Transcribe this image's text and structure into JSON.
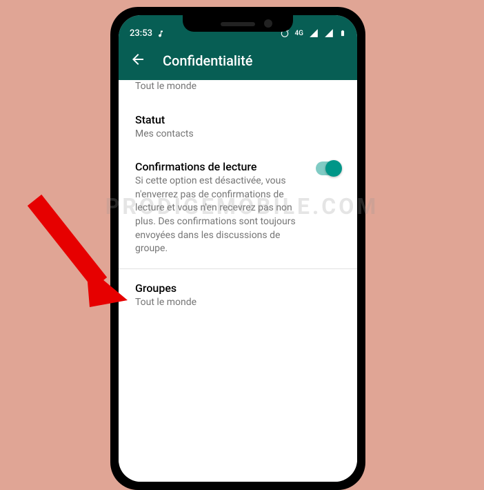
{
  "status_bar": {
    "time": "23:53",
    "network": "4G"
  },
  "header": {
    "title": "Confidentialité"
  },
  "settings": {
    "item0_subtitle": "Tout le monde",
    "statut": {
      "title": "Statut",
      "subtitle": "Mes contacts"
    },
    "read_receipts": {
      "title": "Confirmations de lecture",
      "description": "Si cette option est désactivée, vous n'enverrez pas de confirmations de lecture et vous n'en recevrez pas non plus. Des confirmations sont toujours envoyées dans les discussions de groupe."
    },
    "groupes": {
      "title": "Groupes",
      "subtitle": "Tout le monde"
    }
  },
  "watermark": "PRODIGEMOBILE.COM"
}
